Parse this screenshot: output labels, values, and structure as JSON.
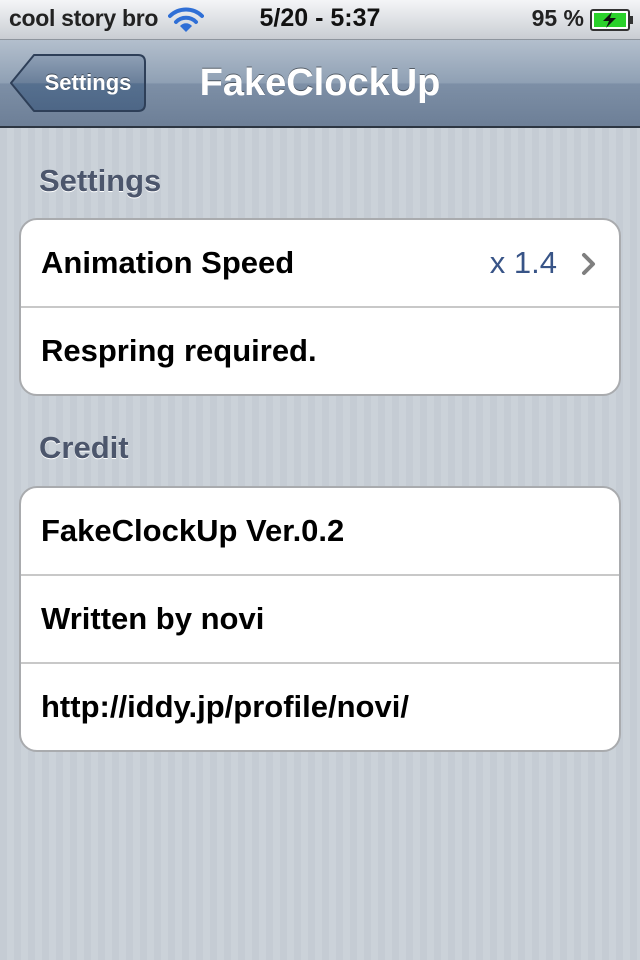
{
  "status_bar": {
    "carrier": "cool story bro",
    "time": "5/20 - 5:37",
    "battery": "95 %",
    "icons": [
      "wifi-icon",
      "battery-charging-icon"
    ]
  },
  "nav_bar": {
    "back_label": "Settings",
    "title": "FakeClockUp"
  },
  "sections": [
    {
      "header": "Settings",
      "rows": [
        {
          "label": "Animation Speed",
          "value": "x 1.4",
          "disclosure": "chevron-right-icon"
        },
        {
          "label": "Respring required."
        }
      ]
    },
    {
      "header": "Credit",
      "rows": [
        {
          "label": "FakeClockUp Ver.0.2"
        },
        {
          "label": "Written by novi"
        },
        {
          "label": "http://iddy.jp/profile/novi/"
        }
      ]
    }
  ],
  "colors": {
    "value_text": "#385487",
    "section_header": "#4c566c",
    "battery_fill": "#2bd12b"
  }
}
